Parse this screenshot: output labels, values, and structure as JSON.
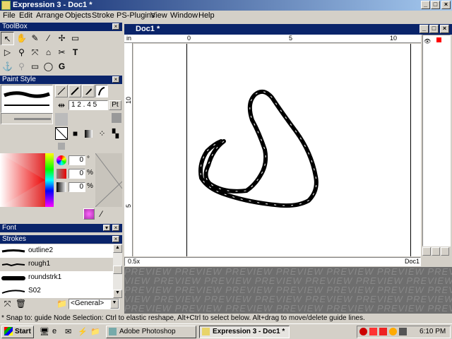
{
  "window": {
    "title": "Expression 3 - Doc1 *"
  },
  "menu": [
    "File",
    "Edit",
    "Arrange",
    "Objects",
    "Stroke",
    "PS-Plugins",
    "View",
    "Window",
    "Help"
  ],
  "toolbox": {
    "title": "ToolBox"
  },
  "paint_style": {
    "title": "Paint Style",
    "width_value": "1 2 . 4 5",
    "width_unit": "Pt",
    "hue_value": "0",
    "hue_unit": "°",
    "sat_value": "0",
    "sat_unit": "%",
    "light_value": "0",
    "light_unit": "%"
  },
  "font_panel": {
    "title": "Font"
  },
  "strokes_panel": {
    "title": "Strokes",
    "items": [
      "outline2",
      "rough1",
      "roundstrk1",
      "S02"
    ],
    "selected": "rough1",
    "category": "<General>"
  },
  "document": {
    "title": "Doc1 *",
    "ruler_unit": "in",
    "ruler_h": [
      "0",
      "5",
      "10"
    ],
    "ruler_v": [
      "10",
      "5"
    ],
    "zoom": "0.5x",
    "status_name": "Doc1"
  },
  "preview_text": "PREVIEW",
  "status": "* Snap to: guide   Node Selection: Ctrl to elastic reshape, Alt+Ctrl to select below. Alt+drag to move/delete guide lines.",
  "taskbar": {
    "start": "Start",
    "apps": [
      "Adobe Photoshop",
      "Expression 3 - Doc1 *"
    ],
    "active": "Expression 3 - Doc1 *",
    "clock": "6:10 PM"
  },
  "colors": {
    "title_active": "#0a246a",
    "face": "#d4d0c8",
    "canvas": "#ffffff",
    "preview_bg": "#6e6e6e"
  }
}
